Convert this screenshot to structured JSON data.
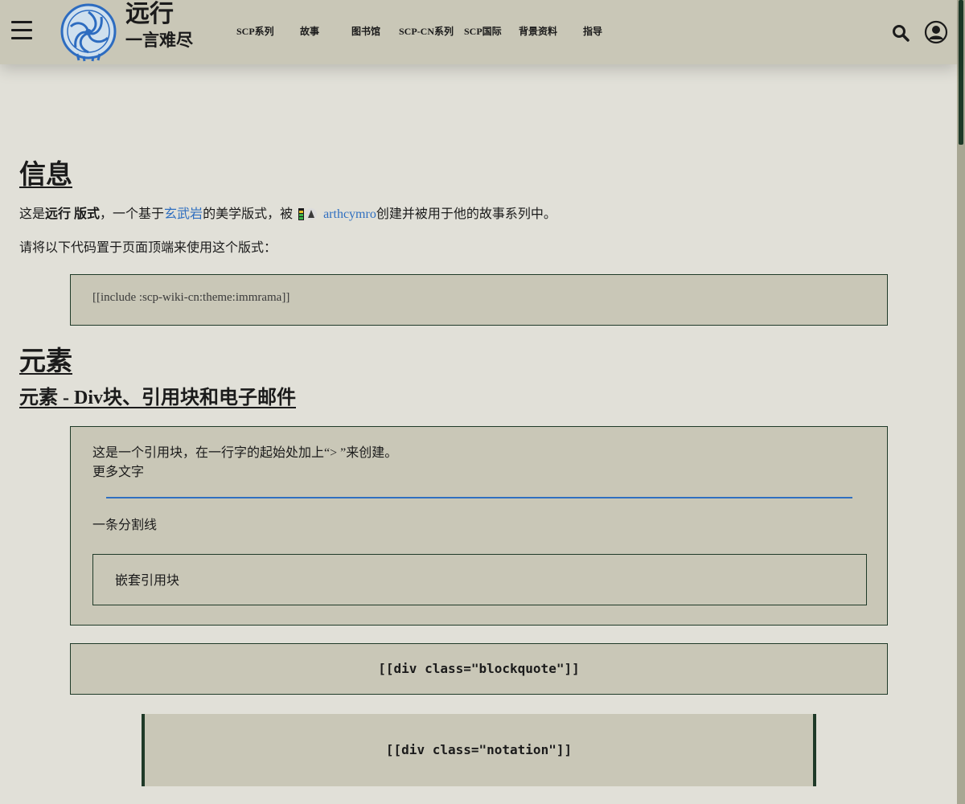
{
  "header": {
    "title": "远行",
    "subtitle": "一言难尽",
    "nav": [
      "SCP系列",
      "故事",
      "图书馆",
      "SCP-CN系列",
      "SCP国际",
      "背景资料",
      "指导"
    ]
  },
  "info": {
    "heading": "信息",
    "line1_prefix": "这是",
    "line1_bold": "远行 版式",
    "line1_mid": "，一个基于",
    "line1_link": "玄武岩",
    "line1_mid2": "的美学版式，被",
    "author": "arthcymro",
    "line1_suffix": "创建并被用于他的故事系列中。",
    "line2": "请将以下代码置于页面顶端来使用这个版式：",
    "code": "[[include :scp-wiki-cn:theme:immrama]]"
  },
  "elements": {
    "heading": "元素",
    "subheading": "元素 - Div块、引用块和电子邮件",
    "quote_line1": "这是一个引用块，在一行字的起始处加上“> ”来创建。",
    "quote_line2": "更多文字",
    "divider_label": "一条分割线",
    "nested_quote": "嵌套引用块",
    "blockquote_div": "[[div class=\"blockquote\"]]",
    "notation_div": "[[div class=\"notation\"]]"
  },
  "colors": {
    "background": "#e1e0d8",
    "panel": "#c9c7b7",
    "border": "#1f3a28",
    "link": "#2f6fc0"
  }
}
